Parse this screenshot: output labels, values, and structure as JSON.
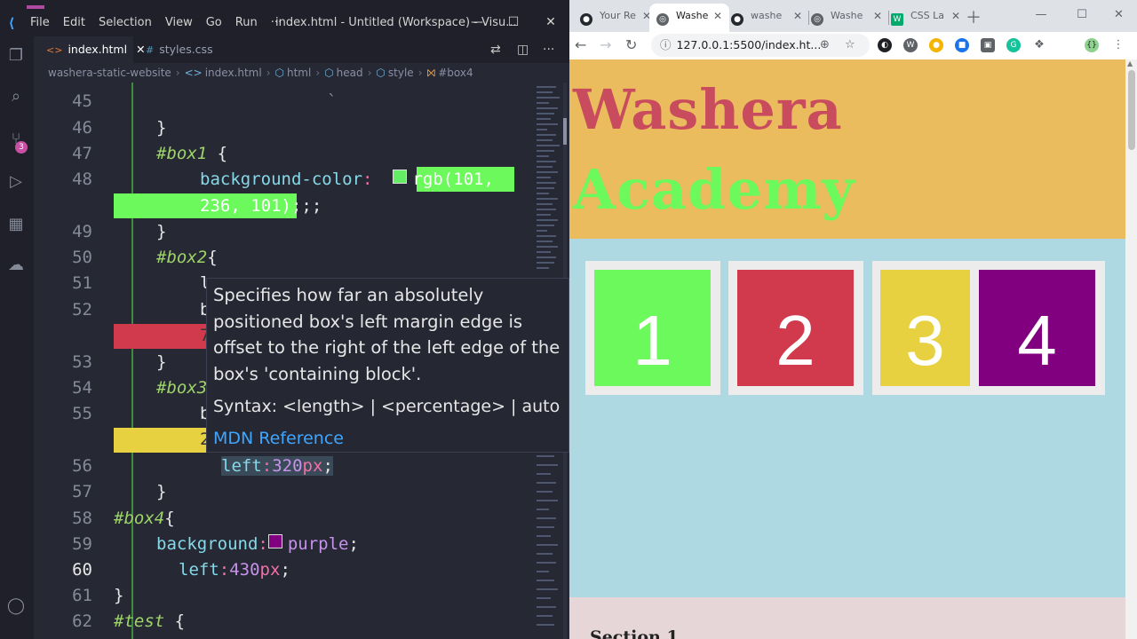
{
  "vscode": {
    "menu": [
      "File",
      "Edit",
      "Selection",
      "View",
      "Go",
      "Run",
      "···"
    ],
    "window_title": "index.html - Untitled (Workspace) - Visu...",
    "tabs": [
      {
        "label": "index.html",
        "active": true,
        "icon": "<>",
        "close": "✕"
      },
      {
        "label": "styles.css",
        "active": false,
        "icon": "#"
      }
    ],
    "breadcrumb": [
      "washera-static-website",
      "index.html",
      "html",
      "head",
      "style",
      "#box4"
    ],
    "scm_badge": "3",
    "lines": [
      {
        "n": "45",
        "text": "",
        "current": false
      },
      {
        "n": "46",
        "text": "}",
        "current": false
      },
      {
        "n": "47",
        "text": "#box1 {",
        "current": false
      },
      {
        "n": "48",
        "text": "background-color:",
        "current": false
      },
      {
        "n": "49",
        "text": "}",
        "current": false
      },
      {
        "n": "50",
        "text": "#box2{",
        "current": false
      },
      {
        "n": "51",
        "text": "l",
        "current": false
      },
      {
        "n": "52",
        "text": "b",
        "current": false
      },
      {
        "n": "53",
        "text": "}",
        "current": false
      },
      {
        "n": "54",
        "text": "#box3",
        "current": false
      },
      {
        "n": "55",
        "text": "b",
        "current": false
      },
      {
        "n": "56",
        "text": "left:320px;",
        "current": false
      },
      {
        "n": "57",
        "text": "}",
        "current": false
      },
      {
        "n": "58",
        "text": "#box4{",
        "current": false
      },
      {
        "n": "59",
        "text": "background:",
        "current": false
      },
      {
        "n": "60",
        "text": "left:430px;",
        "current": true
      },
      {
        "n": "61",
        "text": "}",
        "current": false
      },
      {
        "n": "62",
        "text": "#test {",
        "current": false
      }
    ],
    "code": {
      "box1_selector": "#box1",
      "bg_prop": "background-color",
      "rgb_part1": "rgb(101,",
      "rgb_part2": "236, 101)",
      "rgb_tail": ";;;",
      "box2_selector": "#box2",
      "box3_selector": "#box3",
      "line52_wrap": "7",
      "line55_wrap": "2",
      "left_prop": "left",
      "left_320": "320",
      "px": "px",
      "semi": ";",
      "box4_selector": "#box4",
      "background_prop": "background",
      "purple": "purple",
      "left_430": "430",
      "brace_open": "{",
      "brace_close": "}",
      "test_selector": "#test"
    },
    "hover": {
      "description": "Specifies how far an absolutely positioned box's left margin edge is offset to the right of the left edge of the box's 'containing block'.",
      "syntax": "Syntax: <length> | <percentage> | auto",
      "link": "MDN Reference"
    },
    "colors": {
      "green": "#65ec65",
      "red": "#d13a4d",
      "yellow": "#e8d141",
      "purple": "#800080"
    }
  },
  "browser": {
    "tabs": [
      {
        "label": "Your Re",
        "icon": "github-icon"
      },
      {
        "label": "Washe",
        "icon": "globe-icon",
        "active": true
      },
      {
        "label": "washe",
        "icon": "github-icon"
      },
      {
        "label": "Washe",
        "icon": "globe-icon"
      },
      {
        "label": "CSS La",
        "icon": "w3-icon"
      }
    ],
    "tab_close": "✕",
    "url": "127.0.0.1:5500/index.ht...",
    "page": {
      "title_line1": "Washera",
      "title_line2": "Academy",
      "boxes": [
        {
          "label": "1",
          "color": "#6bf95b"
        },
        {
          "label": "2",
          "color": "#d13a4d"
        },
        {
          "label": "3",
          "color": "#e8d141"
        },
        {
          "label": "4",
          "color": "#800080"
        }
      ],
      "section_title": "Section 1",
      "colors": {
        "header_bg": "#eabc5d",
        "body_bg": "#afd9e2",
        "section_bg": "#e7d6d8"
      }
    }
  }
}
